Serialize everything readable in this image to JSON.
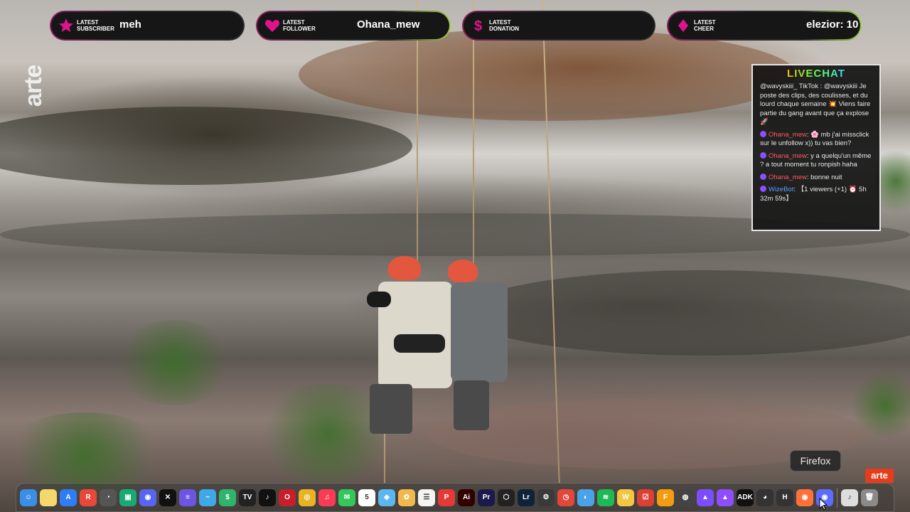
{
  "alerts": [
    {
      "label_line1": "LATEST",
      "label_line2": "SUBSCRIBER",
      "value": "meh",
      "icon": "star-icon",
      "accent": "#e0138c"
    },
    {
      "label_line1": "LATEST",
      "label_line2": "FOLLOWER",
      "value": "Ohana_mew",
      "icon": "heart-icon",
      "accent": "#e0138c"
    },
    {
      "label_line1": "LATEST",
      "label_line2": "DONATION",
      "value": "",
      "icon": "dollar-icon",
      "accent": "#e0138c"
    },
    {
      "label_line1": "LATEST",
      "label_line2": "CHEER",
      "value": "elezior: 10",
      "icon": "diamond-icon",
      "accent": "#e0138c"
    }
  ],
  "watermark": {
    "brand": "arte",
    "corner_brand": "arte"
  },
  "livechat": {
    "title": "LIVECHAT",
    "messages": [
      {
        "user": "",
        "text": "@wavyskiii_ TikTok : @wavyskiii Je poste des clips, des coulisses, et du lourd chaque semaine 💥 Viens faire partie du gang avant que ça explose 🚀"
      },
      {
        "user": "Ohana_mew",
        "text": ": 🌸 mb j'ai missclick sur le unfollow x)) tu vas bien?"
      },
      {
        "user": "Ohana_mew",
        "text": ": y a quelqu'un même ? a tout moment tu ronpish haha"
      },
      {
        "user": "Ohana_mew",
        "text": ": bonne nuit"
      },
      {
        "user": "WizeBot",
        "text": ": 【1 viewers (+1) ⏰ 5h 32m 59s】"
      }
    ]
  },
  "tooltip": {
    "text": "Firefox"
  },
  "dock": {
    "items": [
      {
        "name": "finder-icon",
        "color": "#3a8ee6",
        "glyph": "☺"
      },
      {
        "name": "notes-icon",
        "color": "#f5d76e",
        "glyph": ""
      },
      {
        "name": "app-store-icon",
        "color": "#2e7cf6",
        "glyph": "A"
      },
      {
        "name": "reeder-icon",
        "color": "#e8473b",
        "glyph": "R"
      },
      {
        "name": "activity-icon",
        "color": "#555555",
        "glyph": "◔"
      },
      {
        "name": "android-icon",
        "color": "#19a974",
        "glyph": "▣"
      },
      {
        "name": "discord-icon",
        "color": "#5865f2",
        "glyph": "◉"
      },
      {
        "name": "capcut-icon",
        "color": "#111111",
        "glyph": "✕"
      },
      {
        "name": "text-icon",
        "color": "#6c55e0",
        "glyph": "≡"
      },
      {
        "name": "freeform-icon",
        "color": "#3fa8e6",
        "glyph": "~"
      },
      {
        "name": "streamlabs-icon",
        "color": "#2fb46c",
        "glyph": "$"
      },
      {
        "name": "tv-icon",
        "color": "#222222",
        "glyph": "TV"
      },
      {
        "name": "tiktok-icon",
        "color": "#111111",
        "glyph": "♪"
      },
      {
        "name": "opera-icon",
        "color": "#c81d2b",
        "glyph": "O"
      },
      {
        "name": "chrome-icon",
        "color": "#e8b423",
        "glyph": "◎"
      },
      {
        "name": "music-icon",
        "color": "#fa3b56",
        "glyph": "♫"
      },
      {
        "name": "messages-icon",
        "color": "#34c759",
        "glyph": "✉"
      },
      {
        "name": "calendar-icon",
        "color": "#ffffff",
        "glyph": "5"
      },
      {
        "name": "maps-icon",
        "color": "#5bb7f0",
        "glyph": "◈"
      },
      {
        "name": "photos-icon",
        "color": "#f2b84b",
        "glyph": "✿"
      },
      {
        "name": "reminders-icon",
        "color": "#f4f4f4",
        "glyph": "☰"
      },
      {
        "name": "pdf-icon",
        "color": "#e53935",
        "glyph": "P"
      },
      {
        "name": "illustrator-icon",
        "color": "#330000",
        "glyph": "Ai"
      },
      {
        "name": "premiere-icon",
        "color": "#1c1a4a",
        "glyph": "Pr"
      },
      {
        "name": "unity-icon",
        "color": "#222222",
        "glyph": "⬡"
      },
      {
        "name": "lightroom-icon",
        "color": "#0f2238",
        "glyph": "Lr"
      },
      {
        "name": "steam-icon",
        "color": "#3a3a3a",
        "glyph": "⚙"
      },
      {
        "name": "clock-icon",
        "color": "#e2473c",
        "glyph": "◷"
      },
      {
        "name": "vpn-icon",
        "color": "#4aa3e8",
        "glyph": "◐"
      },
      {
        "name": "spotify-icon",
        "color": "#1db954",
        "glyph": "≋"
      },
      {
        "name": "waves-icon",
        "color": "#f4c542",
        "glyph": "W"
      },
      {
        "name": "todoist-icon",
        "color": "#db4035",
        "glyph": "☑"
      },
      {
        "name": "fl-studio-icon",
        "color": "#f39c12",
        "glyph": "F"
      },
      {
        "name": "obs-icon",
        "color": "#444444",
        "glyph": "◍"
      },
      {
        "name": "proton-icon",
        "color": "#7c4dff",
        "glyph": "▲"
      },
      {
        "name": "protonvpn-icon",
        "color": "#8e4dff",
        "glyph": "▲"
      },
      {
        "name": "adk-icon",
        "color": "#111111",
        "glyph": "ADK"
      },
      {
        "name": "gauge-icon",
        "color": "#333333",
        "glyph": "◕"
      },
      {
        "name": "helix-icon",
        "color": "#333333",
        "glyph": "H"
      },
      {
        "name": "firefox-icon",
        "color": "#ff7139",
        "glyph": "◉"
      },
      {
        "name": "firefox-dev-icon",
        "color": "#5b6cff",
        "glyph": "◉"
      },
      {
        "name": "music-doc-icon",
        "color": "#dddddd",
        "glyph": "♪"
      },
      {
        "name": "trash-icon",
        "color": "#8a8a8a",
        "glyph": "🗑"
      }
    ]
  }
}
